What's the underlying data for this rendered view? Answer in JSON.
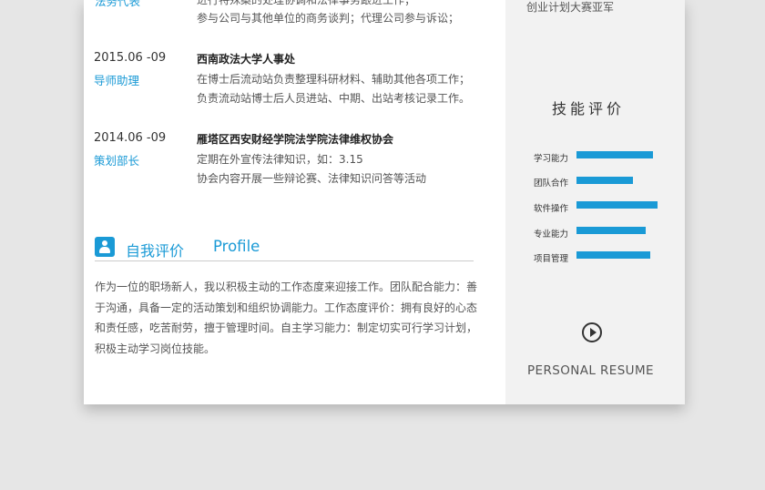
{
  "top_partial": {
    "role": "法务代表",
    "desc_line": "进行特殊案的处理协调和法律事务跟进工作；",
    "desc_line2": "参与公司与其他单位的商务谈判；代理公司参与诉讼；",
    "sidebar_award": "创业计划大赛亚军"
  },
  "experience": [
    {
      "date": "2015.06 -09",
      "role": "导师助理",
      "org": "西南政法大学人事处",
      "lines": [
        "在博士后流动站负责整理科研材料、辅助其他各项工作；",
        "负责流动站博士后人员进站、中期、出站考核记录工作。"
      ]
    },
    {
      "date": "2014.06 -09",
      "role": "策划部长",
      "org": "雁塔区西安财经学院法学院法律维权协会",
      "lines": [
        "定期在外宣传法律知识，如：3.15",
        "协会内容开展一些辩论赛、法律知识问答等活动"
      ]
    }
  ],
  "self_eval": {
    "title_cn": "自我评价",
    "title_en": "Profile",
    "lines": [
      "作为一位的职场新人，我以积极主动的工作态度来迎接工作。团队配合能力：善",
      "于沟通，具备一定的活动策划和组织协调能力。工作态度评价：拥有良好的心态",
      "和责任感，吃苦耐劳，擅于管理时间。自主学习能力：制定切实可行学习计划，",
      "积极主动学习岗位技能。"
    ]
  },
  "skills": {
    "title": "技能评价",
    "items": [
      {
        "label": "学习能力",
        "level": 0.88
      },
      {
        "label": "团队合作",
        "level": 0.65
      },
      {
        "label": "软件操作",
        "level": 0.93
      },
      {
        "label": "专业能力",
        "level": 0.79
      },
      {
        "label": "项目管理",
        "level": 0.84
      }
    ],
    "accent": "#1a9ad6"
  },
  "footer": {
    "icon": "play-circle-icon",
    "text": "PERSONAL RESUME"
  }
}
